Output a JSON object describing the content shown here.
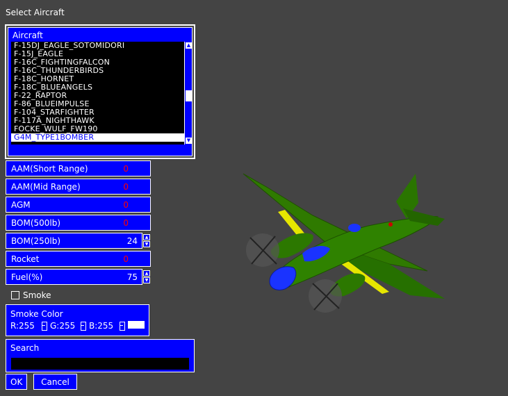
{
  "window_title": "Select Aircraft",
  "aircraft": {
    "label": "Aircraft",
    "items": [
      "F-15DJ_EAGLE_SOTOMIDORI",
      "F-15J_EAGLE",
      "F-16C_FIGHTINGFALCON",
      "F-16C_THUNDERBIRDS",
      "F-18C_HORNET",
      "F-18C_BLUEANGELS",
      "F-22_RAPTOR",
      "F-86_BLUEIMPULSE",
      "F-104_STARFIGHTER",
      "F-117A_NIGHTHAWK",
      "FOCKE_WULF_FW190",
      "G4M_TYPE1BOMBER"
    ],
    "selected_index": 11
  },
  "weapons": [
    {
      "label": "AAM(Short Range)",
      "value": "0",
      "spinner": false
    },
    {
      "label": "AAM(Mid Range)",
      "value": "0",
      "spinner": false
    },
    {
      "label": "AGM",
      "value": "0",
      "spinner": false
    },
    {
      "label": "BOM(500lb)",
      "value": "0",
      "spinner": false
    },
    {
      "label": "BOM(250lb)",
      "value": "24",
      "spinner": true
    },
    {
      "label": "Rocket",
      "value": "0",
      "spinner": false
    },
    {
      "label": "Fuel(%)",
      "value": "75",
      "spinner": true
    }
  ],
  "smoke": {
    "label": "Smoke",
    "checked": false
  },
  "smoke_color": {
    "label": "Smoke Color",
    "r": "R:255",
    "g": "G:255",
    "b": "B:255",
    "swatch_color": "#ffffff"
  },
  "search": {
    "label": "Search",
    "value": ""
  },
  "buttons": {
    "ok": "OK",
    "cancel": "Cancel"
  },
  "colors": {
    "panel": "#0000ff",
    "background": "#444444",
    "zero_value": "#ff0000"
  }
}
